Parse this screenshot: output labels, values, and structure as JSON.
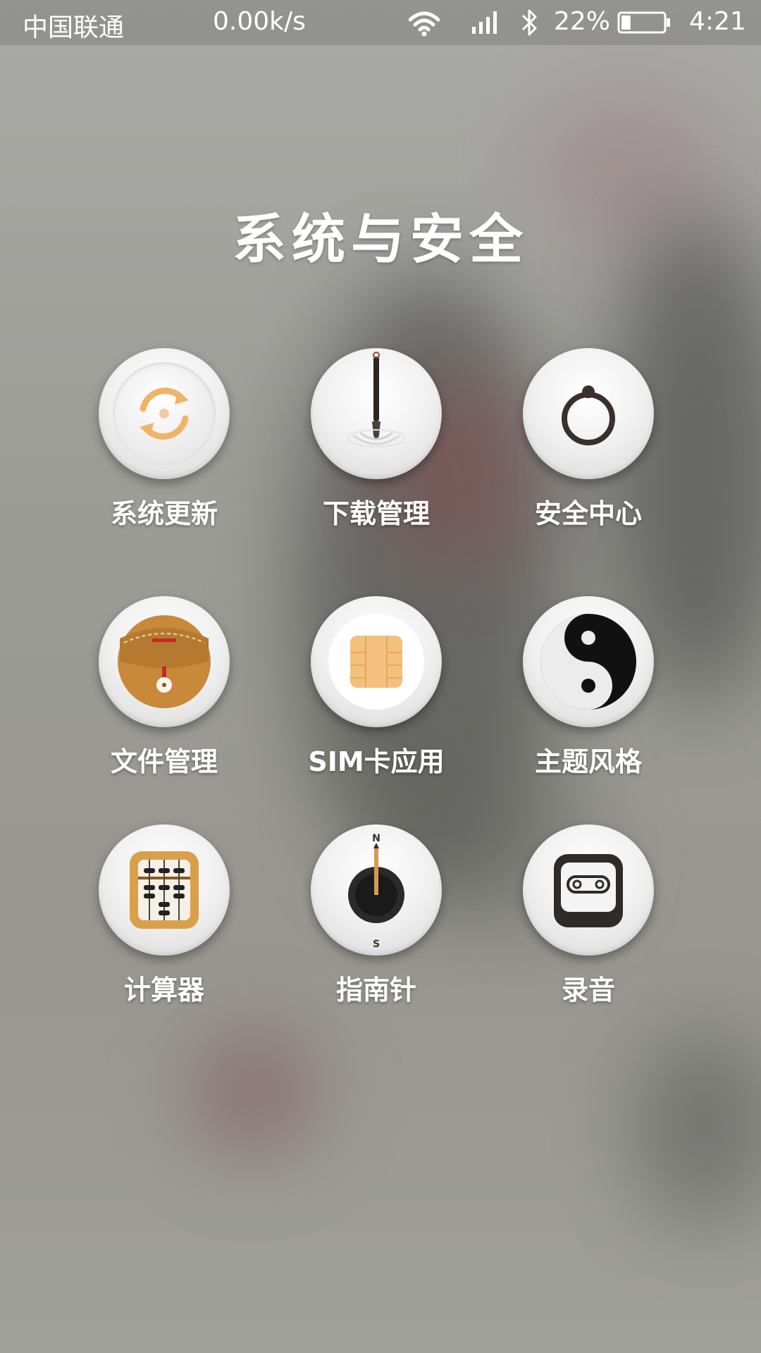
{
  "status_bar": {
    "carrier": "中国联通",
    "network_speed": "0.00k/s",
    "battery_percent": "22%",
    "battery_level": 0.22,
    "time": "4:21",
    "icons": [
      "wifi-icon",
      "signal-icon",
      "bluetooth-icon",
      "battery-icon"
    ]
  },
  "page": {
    "title": "系统与安全"
  },
  "apps": [
    {
      "label": "系统更新",
      "icon": "refresh-icon"
    },
    {
      "label": "下载管理",
      "icon": "brush-icon"
    },
    {
      "label": "安全中心",
      "icon": "ring-icon"
    },
    {
      "label": "文件管理",
      "icon": "pouch-icon"
    },
    {
      "label": "SIM卡应用",
      "icon": "sim-card-icon"
    },
    {
      "label": "主题风格",
      "icon": "yin-yang-icon"
    },
    {
      "label": "计算器",
      "icon": "abacus-icon"
    },
    {
      "label": "指南针",
      "icon": "compass-icon"
    },
    {
      "label": "录音",
      "icon": "recorder-icon"
    }
  ],
  "colors": {
    "accent_orange": "#f0b36a",
    "text": "#ffffff"
  }
}
